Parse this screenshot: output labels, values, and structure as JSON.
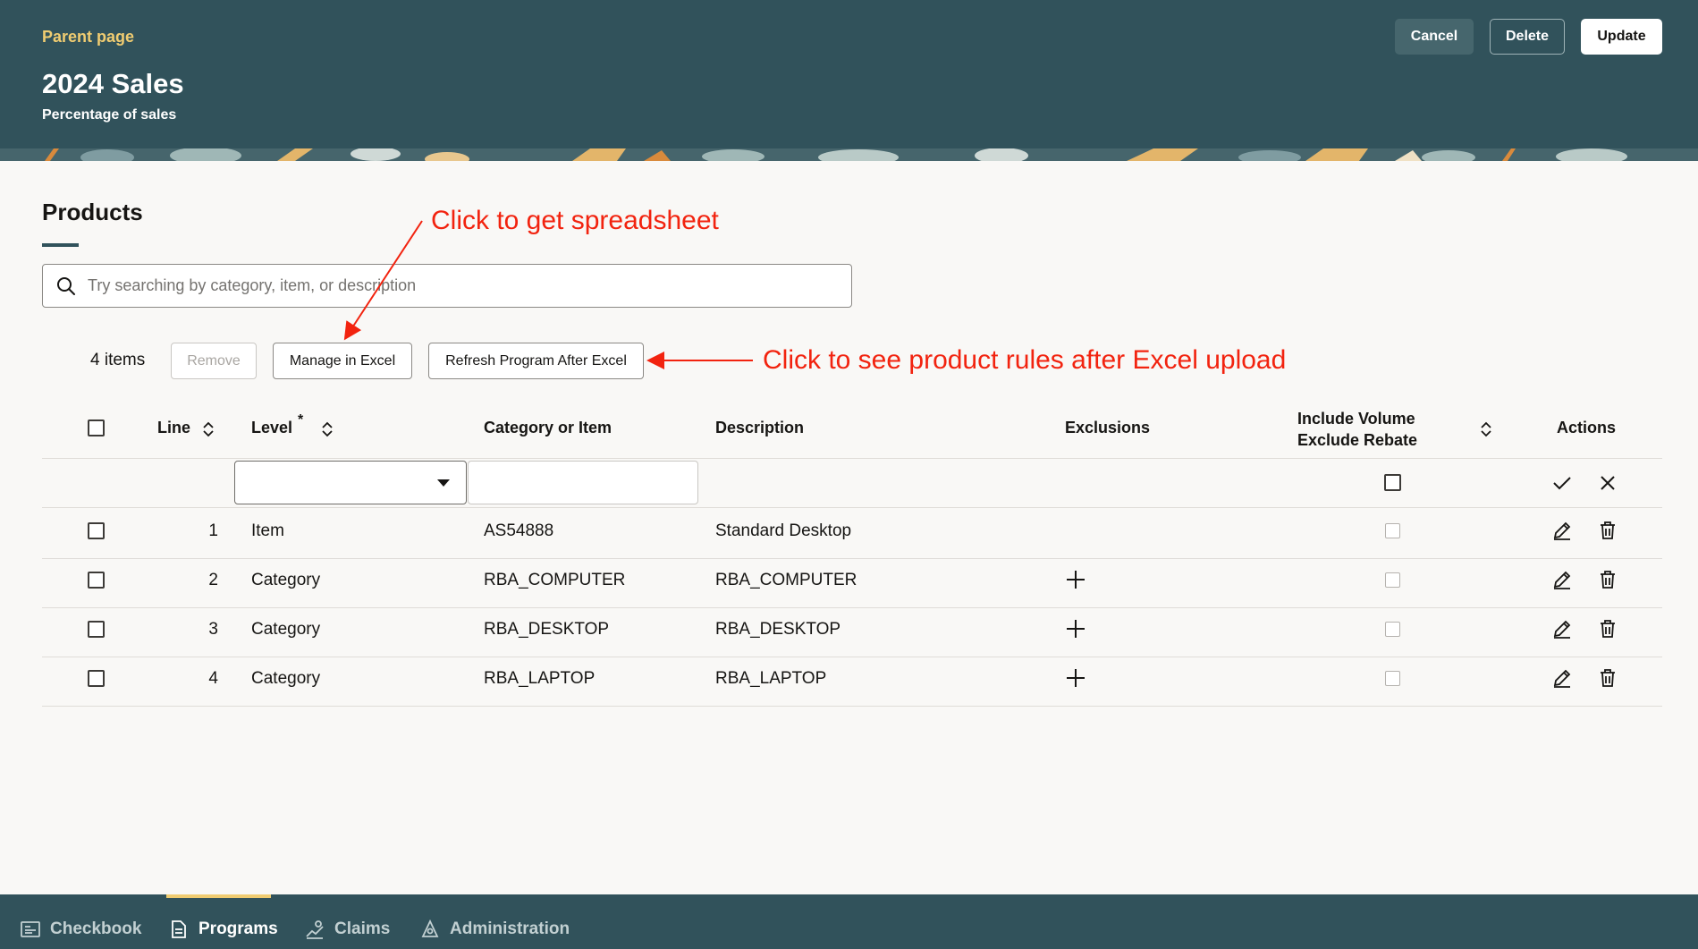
{
  "header": {
    "parent_link": "Parent page",
    "title": "2024 Sales",
    "subtitle": "Percentage of sales",
    "buttons": {
      "cancel": "Cancel",
      "delete": "Delete",
      "update": "Update"
    }
  },
  "products": {
    "title": "Products",
    "search_placeholder": "Try searching by category, item, or description",
    "item_count": "4 items",
    "toolbar": {
      "remove": "Remove",
      "manage_excel": "Manage in Excel",
      "refresh_program": "Refresh Program After Excel"
    },
    "annotations": {
      "spreadsheet": "Click to get spreadsheet",
      "product_rules": "Click to see product rules after Excel upload"
    },
    "columns": {
      "line": "Line",
      "level": "Level",
      "level_required": "*",
      "category_item": "Category or Item",
      "description": "Description",
      "exclusions": "Exclusions",
      "include_volume_1": "Include Volume",
      "include_volume_2": "Exclude Rebate",
      "actions": "Actions"
    },
    "rows": [
      {
        "line": "1",
        "level": "Item",
        "category_item": "AS54888",
        "description": "Standard Desktop",
        "has_exclusion_add": false
      },
      {
        "line": "2",
        "level": "Category",
        "category_item": "RBA_COMPUTER",
        "description": "RBA_COMPUTER",
        "has_exclusion_add": true
      },
      {
        "line": "3",
        "level": "Category",
        "category_item": "RBA_DESKTOP",
        "description": "RBA_DESKTOP",
        "has_exclusion_add": true
      },
      {
        "line": "4",
        "level": "Category",
        "category_item": "RBA_LAPTOP",
        "description": "RBA_LAPTOP",
        "has_exclusion_add": true
      }
    ]
  },
  "bottom_nav": {
    "items": [
      {
        "label": "Checkbook",
        "icon": "checkbook-icon"
      },
      {
        "label": "Programs",
        "icon": "programs-icon",
        "active": true
      },
      {
        "label": "Claims",
        "icon": "claims-icon"
      },
      {
        "label": "Administration",
        "icon": "administration-icon"
      }
    ]
  },
  "colors": {
    "header_bg": "#31525b",
    "accent_gold": "#f0cc71",
    "annotation_red": "#f2230f",
    "page_bg": "#f9f8f6"
  }
}
